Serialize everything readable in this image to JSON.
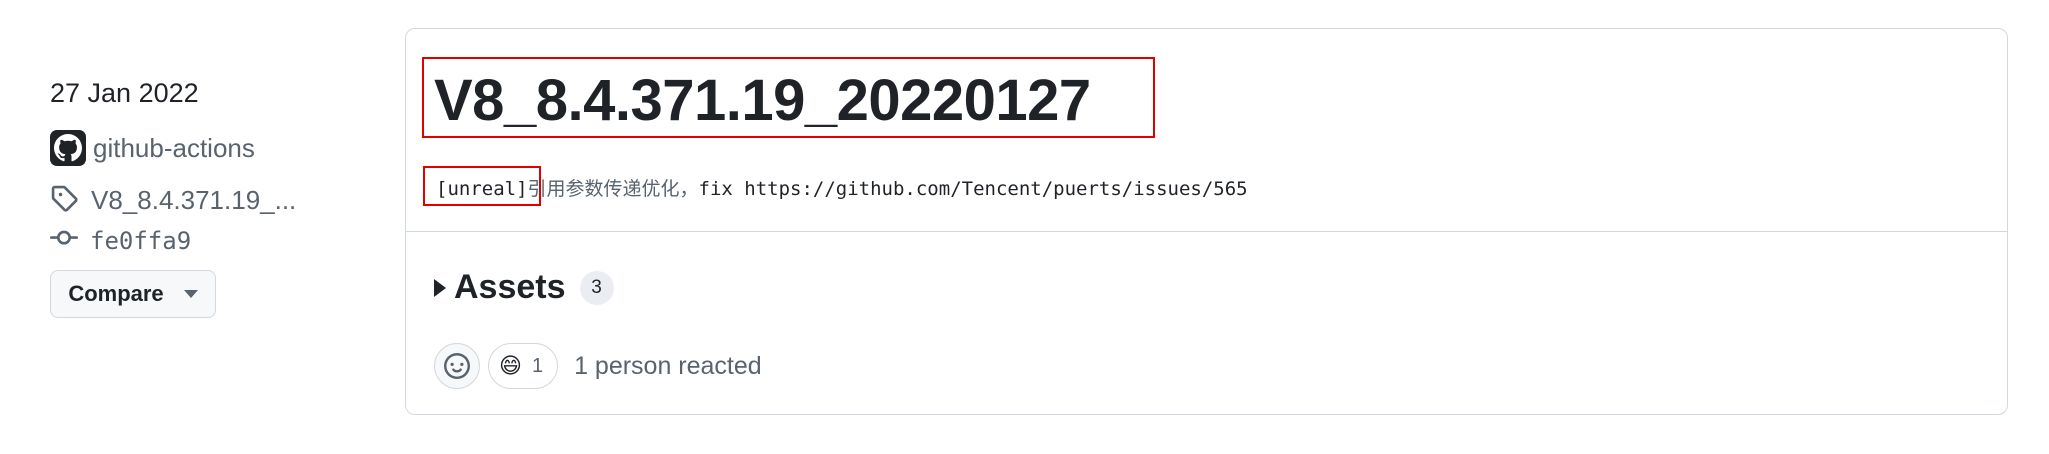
{
  "sidebar": {
    "date": "27 Jan 2022",
    "author": "github-actions",
    "tag": "V8_8.4.371.19_...",
    "commit": "fe0ffa9",
    "compare_label": "Compare"
  },
  "release": {
    "title": "V8_8.4.371.19_20220127",
    "body_tag": "[unreal]",
    "body_cjk": "引用参数传递优化，",
    "body_rest": "fix https://github.com/Tencent/puerts/issues/565"
  },
  "assets": {
    "label": "Assets",
    "count": "3"
  },
  "reactions": {
    "emoji": "😄",
    "emoji_count": "1",
    "summary": "1 person reacted"
  },
  "colors": {
    "highlight_box": "#e00000",
    "text_primary": "#1f2328",
    "text_muted": "#59636e",
    "border": "#d1d9e0"
  },
  "icons": [
    "github-avatar-icon",
    "tag-icon",
    "commit-icon",
    "caret-down-icon",
    "triangle-right-icon",
    "smiley-icon"
  ]
}
